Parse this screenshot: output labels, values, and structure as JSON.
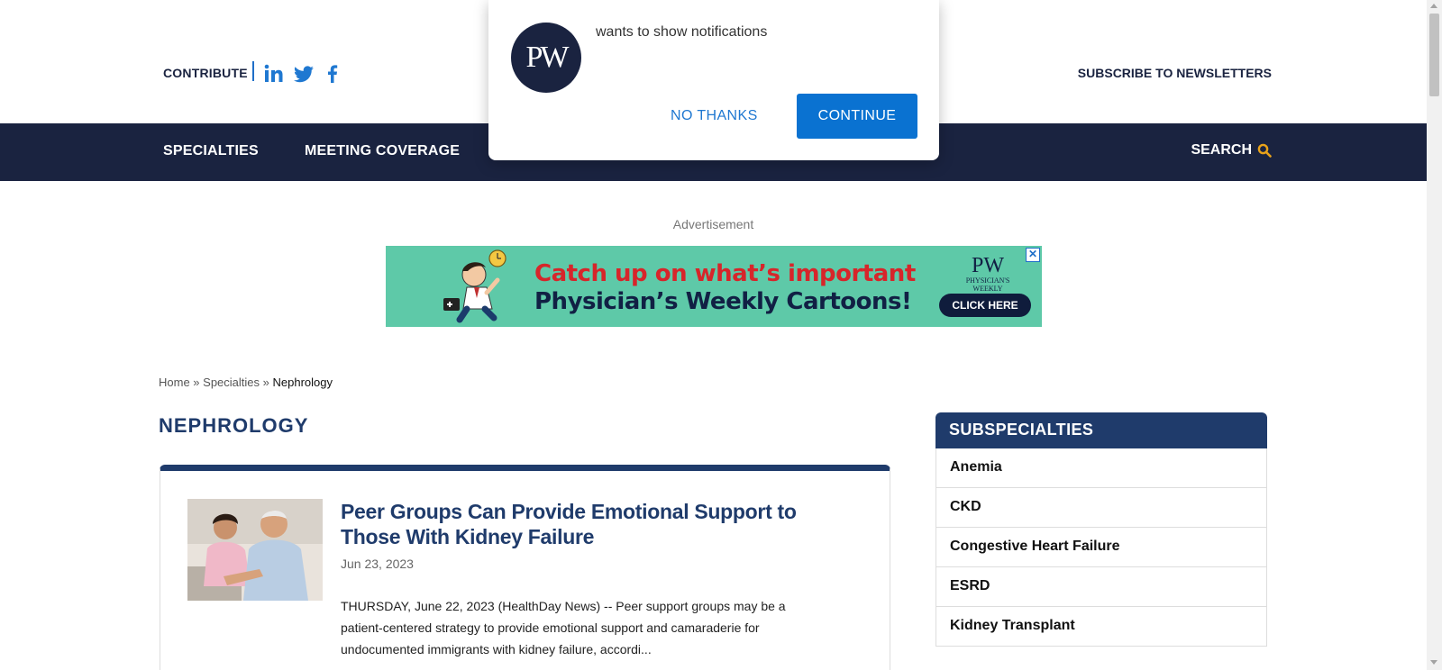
{
  "header": {
    "contribute": "CONTRIBUTE",
    "social": [
      "linkedin-icon",
      "twitter-icon",
      "facebook-icon"
    ],
    "subscribe": "SUBSCRIBE TO NEWSLETTERS"
  },
  "nav": {
    "items": [
      "SPECIALTIES",
      "MEETING COVERAGE"
    ],
    "search": "SEARCH"
  },
  "ad": {
    "label": "Advertisement",
    "line1": "Catch up on what’s important",
    "line2": "Physician’s Weekly Cartoons!",
    "logo": "PW",
    "logo_text": "PHYSICIAN'S WEEKLY",
    "cta": "CLICK HERE",
    "close": "✕"
  },
  "breadcrumb": {
    "home": "Home",
    "sep": " » ",
    "specialties": "Specialties",
    "current": "Nephrology"
  },
  "page_title": "NEPHROLOGY",
  "article": {
    "title": "Peer Groups Can Provide Emotional Support to Those With Kidney Failure",
    "date": "Jun 23, 2023",
    "excerpt": "THURSDAY, June 22, 2023 (HealthDay News) -- Peer support groups may be a patient-centered strategy to provide emotional support and camaraderie for undocumented immigrants with kidney failure, accordi..."
  },
  "sidebar": {
    "heading": "SUBSPECIALTIES",
    "items": [
      "Anemia",
      "CKD",
      "Congestive Heart Failure",
      "ESRD",
      "Kidney Transplant"
    ]
  },
  "popup": {
    "logo": "PW",
    "message": "wants to show notifications",
    "no_thanks": "NO THANKS",
    "continue": "CONTINUE"
  },
  "colors": {
    "navy": "#1a2340",
    "title_blue": "#1f3b6b",
    "link_blue": "#1f78d1",
    "accent_orange": "#e8a21a",
    "ad_green": "#5ec9a8",
    "ad_red": "#d7252a"
  }
}
